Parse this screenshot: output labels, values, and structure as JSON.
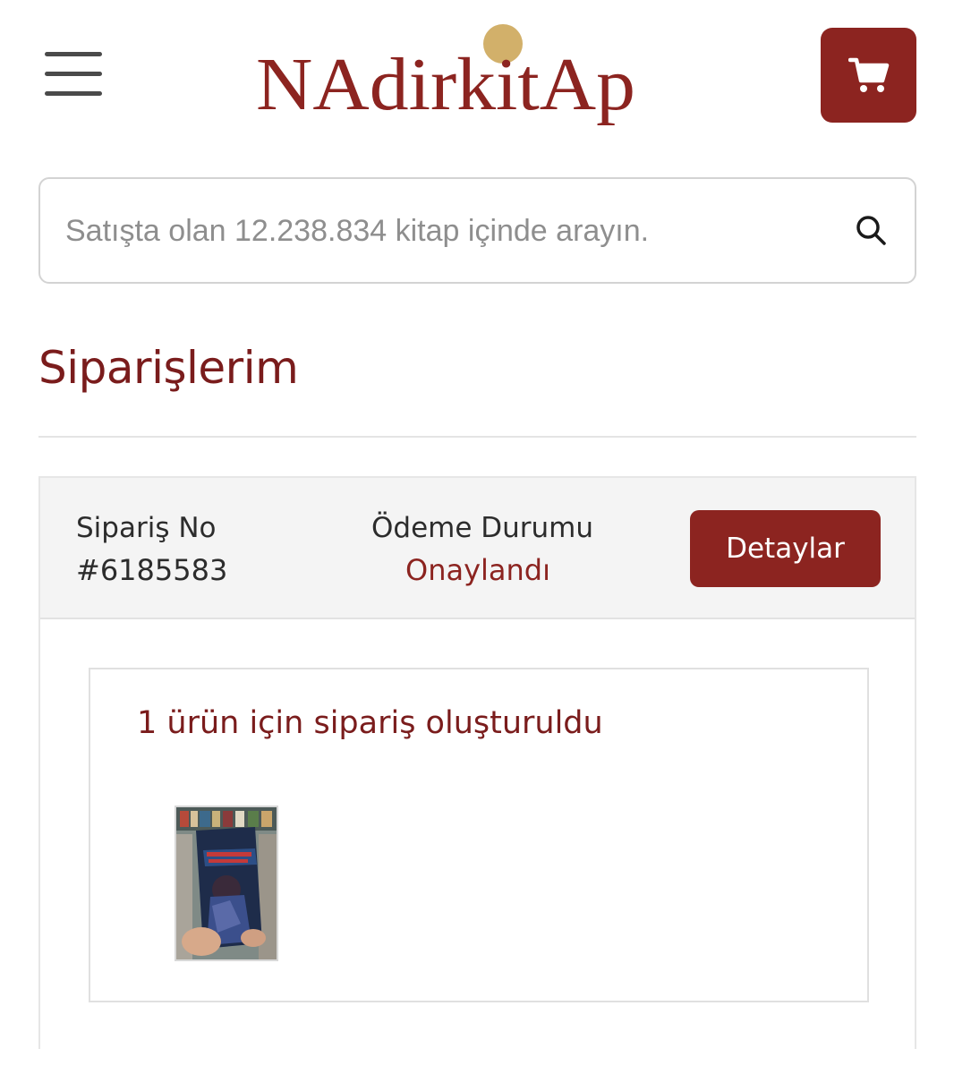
{
  "header": {
    "logo_text": "Nadirkitap",
    "menu_icon": "hamburger-menu-icon",
    "cart_icon": "shopping-cart-icon"
  },
  "search": {
    "placeholder": "Satışta olan 12.238.834 kitap içinde arayın.",
    "icon": "search-icon"
  },
  "page": {
    "title": "Siparişlerim"
  },
  "order": {
    "order_no_label": "Sipariş No",
    "order_no_value": "#6185583",
    "payment_label": "Ödeme Durumu",
    "payment_value": "Onaylandı",
    "details_label": "Detaylar",
    "items_summary": "1 ürün için sipariş oluşturuldu"
  },
  "colors": {
    "brand": "#8c2420",
    "brand_text": "#7a1c1c",
    "logo_dot": "#d2b06a",
    "header_bg": "#f4f4f4"
  }
}
